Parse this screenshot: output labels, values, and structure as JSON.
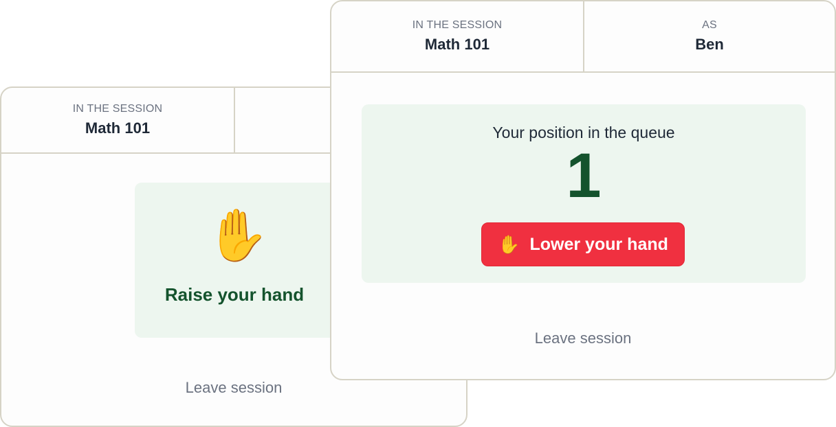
{
  "back_card": {
    "header": {
      "session_kicker": "IN THE SESSION",
      "session_name": "Math 101"
    },
    "raise_emoji": "✋",
    "raise_label": "Raise your hand",
    "leave_label": "Leave session"
  },
  "front_card": {
    "header": {
      "session_kicker": "IN THE SESSION",
      "session_name": "Math 101",
      "as_kicker": "AS",
      "as_name": "Ben"
    },
    "queue_caption": "Your position in the queue",
    "queue_position": "1",
    "lower_emoji": "✋",
    "lower_label": "Lower your hand",
    "leave_label": "Leave session"
  },
  "colors": {
    "panel_bg": "#edf6ef",
    "accent_green": "#14532d",
    "danger_red": "#f03040",
    "border": "#d6d3c6"
  }
}
